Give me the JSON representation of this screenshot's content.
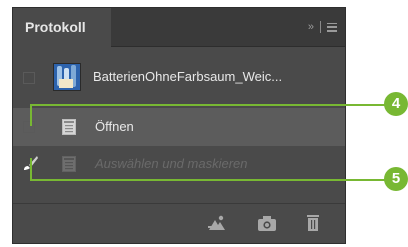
{
  "panel": {
    "tab_title": "Protokoll",
    "collapse_glyph": "»",
    "menu_icon": "hamburger-menu-icon"
  },
  "history": {
    "snapshot_label": "BatterienOhneFarbsaum_Weic...",
    "steps": [
      {
        "label": "Öffnen",
        "icon": "document-icon",
        "state": "selected"
      },
      {
        "label": "Auswählen und maskieren",
        "icon": "document-icon",
        "state": "dimmed"
      }
    ]
  },
  "toolbar": {
    "new_document_icon": "new-document-from-state-icon",
    "snapshot_icon": "camera-icon",
    "delete_icon": "trash-icon"
  },
  "callouts": [
    {
      "number": "4"
    },
    {
      "number": "5"
    }
  ],
  "colors": {
    "callout_green": "#78b833",
    "panel_bg": "#4a4a4a",
    "selected_row": "#5c5c5c"
  }
}
